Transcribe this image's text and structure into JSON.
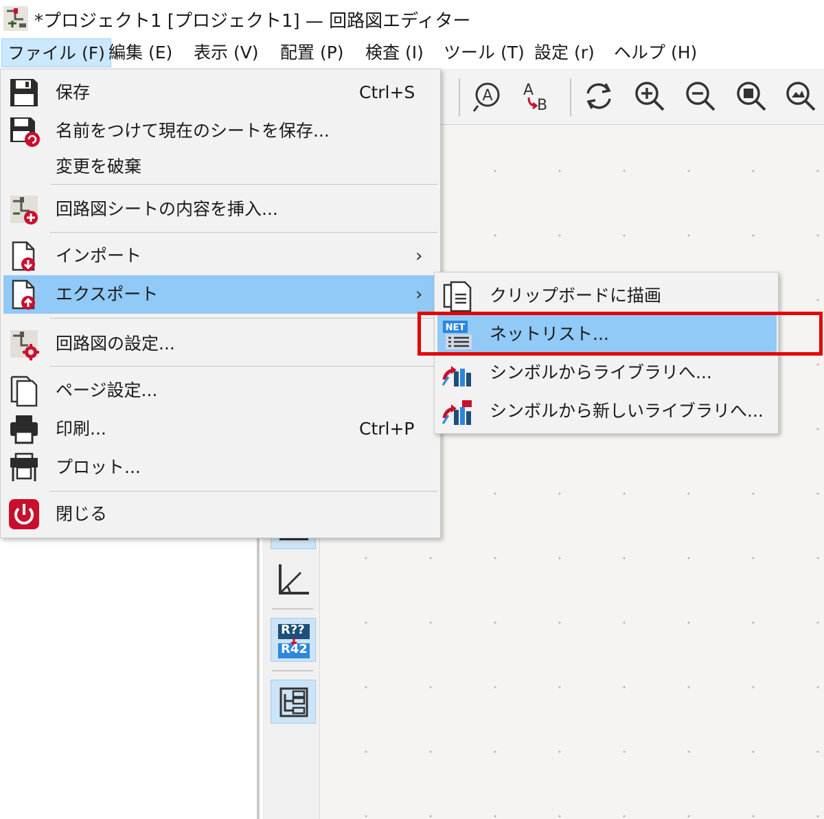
{
  "window": {
    "title": "*プロジェクト1 [プロジェクト1] — 回路図エディター"
  },
  "menubar": {
    "items": [
      {
        "label": "ファイル (F)",
        "active": true
      },
      {
        "label": "編集 (E)"
      },
      {
        "label": "表示 (V)"
      },
      {
        "label": "配置 (P)"
      },
      {
        "label": "検査 (I)"
      },
      {
        "label": "ツール (T)"
      },
      {
        "label": "設定 (r)"
      },
      {
        "label": "ヘルプ (H)"
      }
    ]
  },
  "file_menu": {
    "items": [
      {
        "label": "保存",
        "shortcut": "Ctrl+S",
        "icon": "save-icon"
      },
      {
        "label": "名前をつけて現在のシートを保存...",
        "icon": "save-as-icon"
      },
      {
        "label": "変更を破棄"
      },
      {
        "label": "回路図シートの内容を挿入...",
        "icon": "insert-sheet-icon"
      },
      {
        "label": "インポート",
        "icon": "import-icon",
        "submenu_arrow": "›"
      },
      {
        "label": "エクスポート",
        "icon": "export-icon",
        "submenu_arrow": "›",
        "highlighted": true
      },
      {
        "label": "回路図の設定...",
        "icon": "schematic-settings-icon"
      },
      {
        "label": "ページ設定...",
        "icon": "page-setup-icon"
      },
      {
        "label": "印刷...",
        "shortcut": "Ctrl+P",
        "icon": "print-icon"
      },
      {
        "label": "プロット...",
        "icon": "plot-icon"
      },
      {
        "label": "閉じる",
        "icon": "power-icon"
      }
    ]
  },
  "export_submenu": {
    "items": [
      {
        "label": "クリップボードに描画",
        "icon": "clipboard-icon"
      },
      {
        "label": "ネットリスト...",
        "icon": "netlist-icon",
        "highlighted": true
      },
      {
        "label": "シンボルからライブラリへ...",
        "icon": "symbol-library-icon"
      },
      {
        "label": "シンボルから新しいライブラリへ...",
        "icon": "symbol-new-library-icon"
      }
    ]
  },
  "left_toolbar": {
    "annotate_label_top": "R??",
    "annotate_label_bottom": "R42"
  },
  "colors": {
    "menu_hover": "#91c9f7",
    "active_menu": "#cce8ff",
    "highlight_box": "#e60000",
    "canvas_bg": "#f5f4f0",
    "icon_red": "#c8102e"
  }
}
